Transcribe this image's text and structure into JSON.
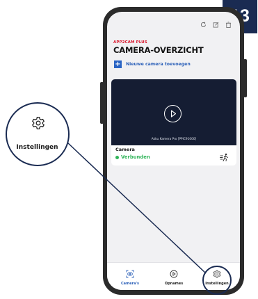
{
  "step_badge": {
    "number": "13"
  },
  "callout": {
    "icon": "gear-icon",
    "label": "Instellingen"
  },
  "header": {
    "icons": [
      "refresh-icon",
      "edit-icon",
      "delete-icon"
    ],
    "app_brand": "APP2CAM PLUS",
    "title": "CAMERA-OVERZICHT"
  },
  "add_camera": {
    "icon": "plus-icon",
    "label": "Nieuwe camera toevoegen"
  },
  "camera_card": {
    "preview_caption": "Akku Kamera Pro [PPIC91000]",
    "name": "Camera",
    "status": "Verbunden",
    "status_color": "#2fb458",
    "motion_icon": "motion-detection-icon"
  },
  "bottom_nav": {
    "items": [
      {
        "label": "Camera's",
        "icon": "camera-icon",
        "active": true
      },
      {
        "label": "Opnames",
        "icon": "play-icon",
        "active": false
      },
      {
        "label": "Instellingen",
        "icon": "gear-icon",
        "active": false
      }
    ]
  },
  "colors": {
    "accent_red": "#d9182d",
    "accent_blue": "#2a5fb8",
    "badge_navy": "#1a2b52",
    "preview_bg": "#151d33"
  }
}
